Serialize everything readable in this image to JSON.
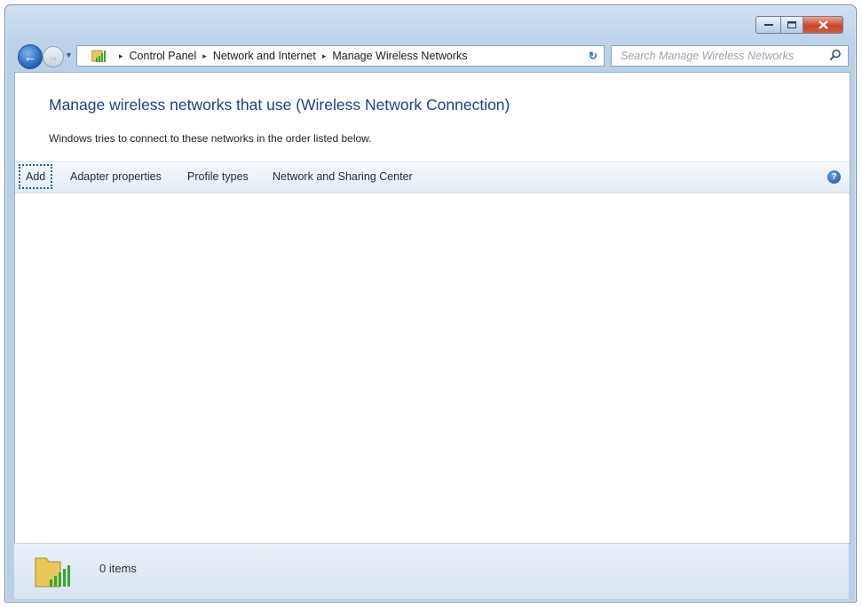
{
  "nav": {
    "back_glyph": "←",
    "forward_glyph": "→",
    "history_glyph": "▼"
  },
  "address": {
    "crumbs": [
      "Control Panel",
      "Network and Internet",
      "Manage Wireless Networks"
    ],
    "separator": "▸",
    "dropdown_glyph": "▾",
    "refresh_glyph": "↻"
  },
  "search": {
    "placeholder": "Search Manage Wireless Networks"
  },
  "main": {
    "heading": "Manage wireless networks that use (Wireless Network Connection)",
    "subtext": "Windows tries to connect to these networks in the order listed below."
  },
  "toolbar": {
    "add": "Add",
    "adapter_properties": "Adapter properties",
    "profile_types": "Profile types",
    "network_sharing_center": "Network and Sharing Center",
    "help_glyph": "?"
  },
  "status": {
    "count": "0 items"
  },
  "colors": {
    "heading": "#1e3f8c",
    "focus_outline": "#1f5fb2",
    "close_button": "#c8452c"
  }
}
